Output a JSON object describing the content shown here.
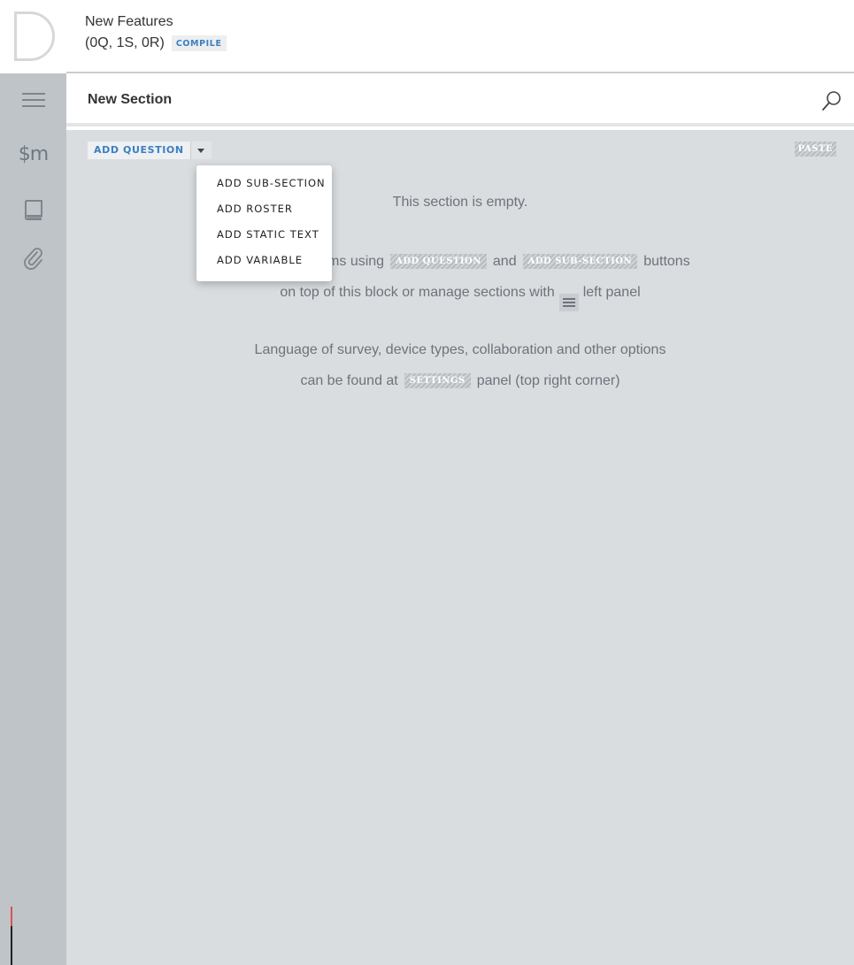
{
  "header": {
    "title": "New Features",
    "stats": "(0Q, 1S, 0R)",
    "compile_label": "COMPILE"
  },
  "sidebar": {
    "logo_letter": "D",
    "items": [
      {
        "icon": "hamburger-menu-icon"
      },
      {
        "icon": "macros-icon",
        "label": "$m"
      },
      {
        "icon": "book-icon"
      },
      {
        "icon": "paperclip-icon"
      }
    ]
  },
  "section": {
    "title": "New Section"
  },
  "toolbar": {
    "add_question_label": "ADD QUESTION",
    "paste_label": "PASTE"
  },
  "dropdown": {
    "items": [
      "ADD SUB-SECTION",
      "ADD ROSTER",
      "ADD STATIC TEXT",
      "ADD VARIABLE"
    ]
  },
  "empty_state": {
    "title": "This section is empty.",
    "line1_prefix": "You can add items using",
    "line1_btn1": "ADD QUESTION",
    "line1_mid": "and",
    "line1_btn2": "ADD SUB-SECTION",
    "line1_suffix": "buttons",
    "line2_prefix": "on top of this block or manage sections with",
    "line2_suffix": "left panel",
    "line3": "Language of survey, device types, collaboration and other options",
    "line4_prefix": "can be found at",
    "line4_btn": "SETTINGS",
    "line4_suffix": "panel (top right corner)"
  }
}
